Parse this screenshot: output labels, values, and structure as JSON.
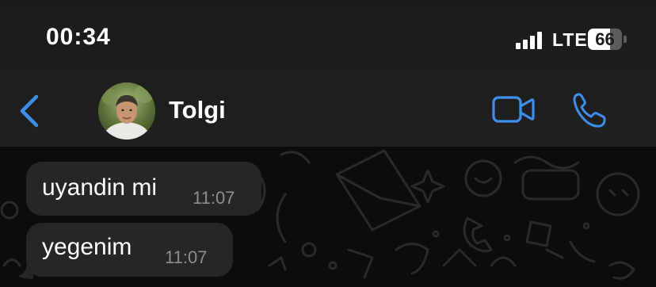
{
  "status_bar": {
    "time": "00:34",
    "network": "LTE",
    "battery_level": "66",
    "battery_fraction": 0.66,
    "signal_bars": 4
  },
  "header": {
    "contact_name": "Tolgi"
  },
  "colors": {
    "accent": "#3e8eec",
    "bubble": "#262627",
    "header_bg": "#1e1e1e",
    "chat_bg": "#0c0c0c"
  },
  "messages": [
    {
      "text": "uyandin mi",
      "time": "11:07"
    },
    {
      "text": "yegenim",
      "time": "11:07"
    }
  ]
}
